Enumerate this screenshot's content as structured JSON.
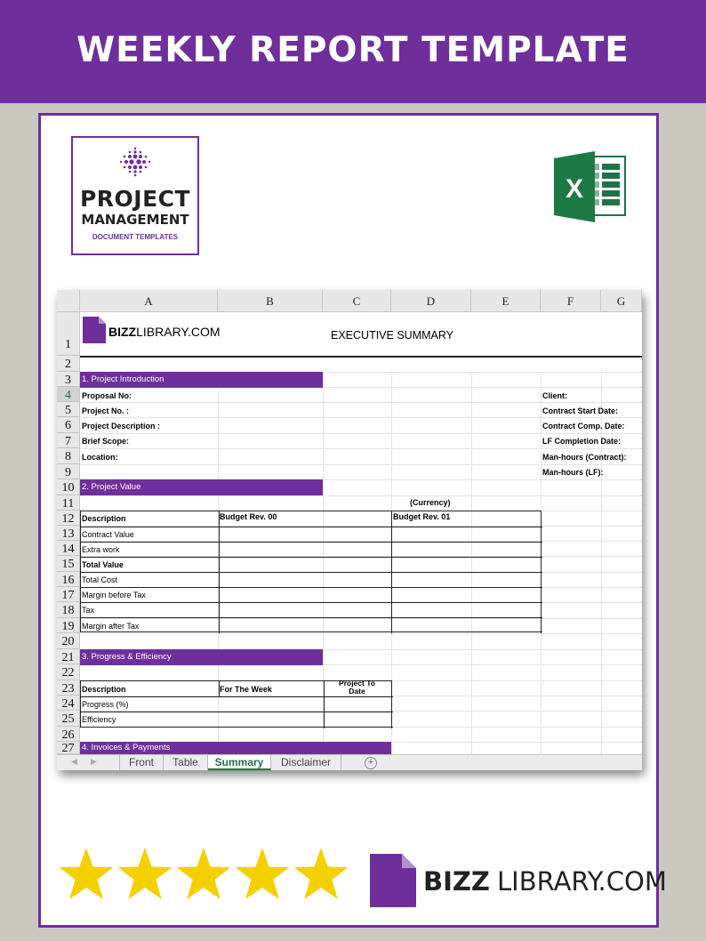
{
  "banner": {
    "title": "WEEKLY REPORT TEMPLATE"
  },
  "logo": {
    "line1": "PROJECT",
    "line2": "MANAGEMENT",
    "line3": "DOCUMENT TEMPLATES"
  },
  "sheet": {
    "columns": [
      "A",
      "B",
      "C",
      "D",
      "E",
      "F",
      "G"
    ],
    "rows": [
      "1",
      "2",
      "3",
      "4",
      "5",
      "6",
      "7",
      "8",
      "9",
      "10",
      "11",
      "12",
      "13",
      "14",
      "15",
      "16",
      "17",
      "18",
      "19",
      "20",
      "21",
      "22",
      "23",
      "24",
      "25",
      "26",
      "27"
    ],
    "brand_bold": "BIZZ",
    "brand_light": "LIBRARY.COM",
    "title": "EXECUTIVE SUMMARY",
    "sections": {
      "intro": "1. Project Introduction",
      "value": "2. Project Value",
      "progress": "3. Progress & Efficiency",
      "invoices": "4. Invoices & Payments"
    },
    "intro_fields": [
      "Proposal No:",
      "Project No. :",
      "Project Description :",
      "Brief Scope:",
      "Location:"
    ],
    "right_fields": [
      "Client:",
      "Contract Start Date:",
      "Contract Comp. Date:",
      "LF Completion Date:",
      "Man-hours (Contract):",
      "Man-hours (LF):"
    ],
    "currency": "(Currency)",
    "value_table": {
      "headers": [
        "Description",
        "Budget Rev. 00",
        "Budget Rev. 01"
      ],
      "rows": [
        "Contract Value",
        "Extra work",
        "Total Value",
        "Total Cost",
        "Margin before Tax",
        "Tax",
        "Margin after Tax"
      ]
    },
    "progress_table": {
      "headers": [
        "Description",
        "For The Week",
        "Project To Date"
      ],
      "rows": [
        "Progress (%)",
        "Efficiency"
      ]
    }
  },
  "tabs": {
    "items": [
      "Front",
      "Table",
      "Summary",
      "Disclaimer"
    ],
    "active": "Summary"
  },
  "rating": {
    "stars": 5,
    "color": "#f5d000"
  },
  "footer_brand": {
    "bold": "BIZZ",
    "light": "LIBRARY.COM"
  },
  "colors": {
    "accent": "#6e2f9b",
    "excel_green": "#217346"
  }
}
